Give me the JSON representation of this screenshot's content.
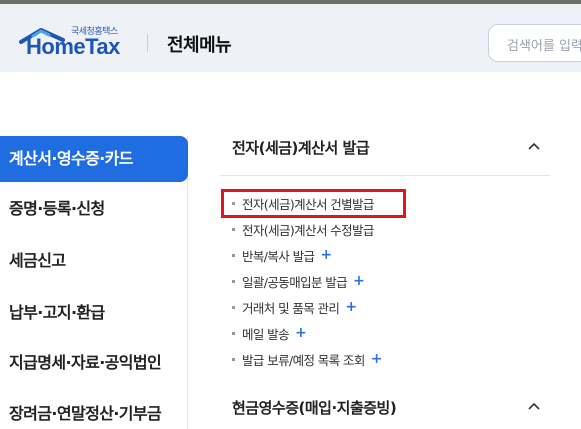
{
  "header": {
    "logo_sub": "국세청홈택스",
    "logo_main": "HomeTax",
    "page_title": "전체메뉴",
    "search_placeholder": "검색어를 입력"
  },
  "sidebar": {
    "items": [
      {
        "label": "계산서·영수증·카드",
        "active": true
      },
      {
        "label": "증명·등록·신청",
        "active": false
      },
      {
        "label": "세금신고",
        "active": false
      },
      {
        "label": "납부·고지·환급",
        "active": false
      },
      {
        "label": "지급명세·자료·공익법인",
        "active": false
      },
      {
        "label": "장려금·연말정산·기부금",
        "active": false
      }
    ]
  },
  "main": {
    "section1": {
      "title": "전자(세금)계산서 발급",
      "items": [
        {
          "label": "전자(세금)계산서 건별발급",
          "plus": "",
          "highlighted": true
        },
        {
          "label": "전자(세금)계산서 수정발급",
          "plus": "",
          "highlighted": false
        },
        {
          "label": "반복/복사 발급",
          "plus": "+",
          "highlighted": false
        },
        {
          "label": "일괄/공동매입분 발급",
          "plus": "+",
          "highlighted": false
        },
        {
          "label": "거래처 및 품목 관리",
          "plus": "+",
          "highlighted": false
        },
        {
          "label": "메일 발송",
          "plus": "+",
          "highlighted": false
        },
        {
          "label": "발급 보류/예정 목록 조회",
          "plus": "+",
          "highlighted": false
        }
      ]
    },
    "section2": {
      "title": "현금영수증(매입·지출증빙)"
    }
  },
  "colors": {
    "accent": "#1f6de0",
    "highlight": "#e4141b",
    "plus": "#2f6fe0"
  }
}
